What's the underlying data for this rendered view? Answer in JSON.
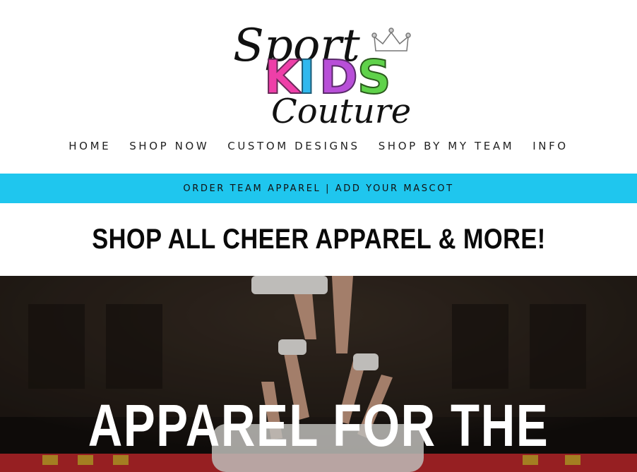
{
  "logo": {
    "line1": "Sport",
    "line2": "KIDS",
    "line3": "Couture"
  },
  "nav": {
    "items": [
      {
        "label": "HOME"
      },
      {
        "label": "SHOP NOW"
      },
      {
        "label": "CUSTOM DESIGNS"
      },
      {
        "label": "SHOP BY MY TEAM"
      },
      {
        "label": "INFO"
      }
    ]
  },
  "announcement": {
    "text": "ORDER TEAM APPAREL  |  ADD YOUR MASCOT",
    "background": "#1fc6ee"
  },
  "page": {
    "title": "SHOP ALL CHEER APPAREL & MORE!"
  },
  "hero": {
    "heading": "APPAREL FOR THE"
  },
  "colors": {
    "accent": "#1fc6ee",
    "kids_k": "#ee3fa8",
    "kids_i": "#2fb8ee",
    "kids_d": "#b84fd8",
    "kids_s": "#5fd24a"
  }
}
